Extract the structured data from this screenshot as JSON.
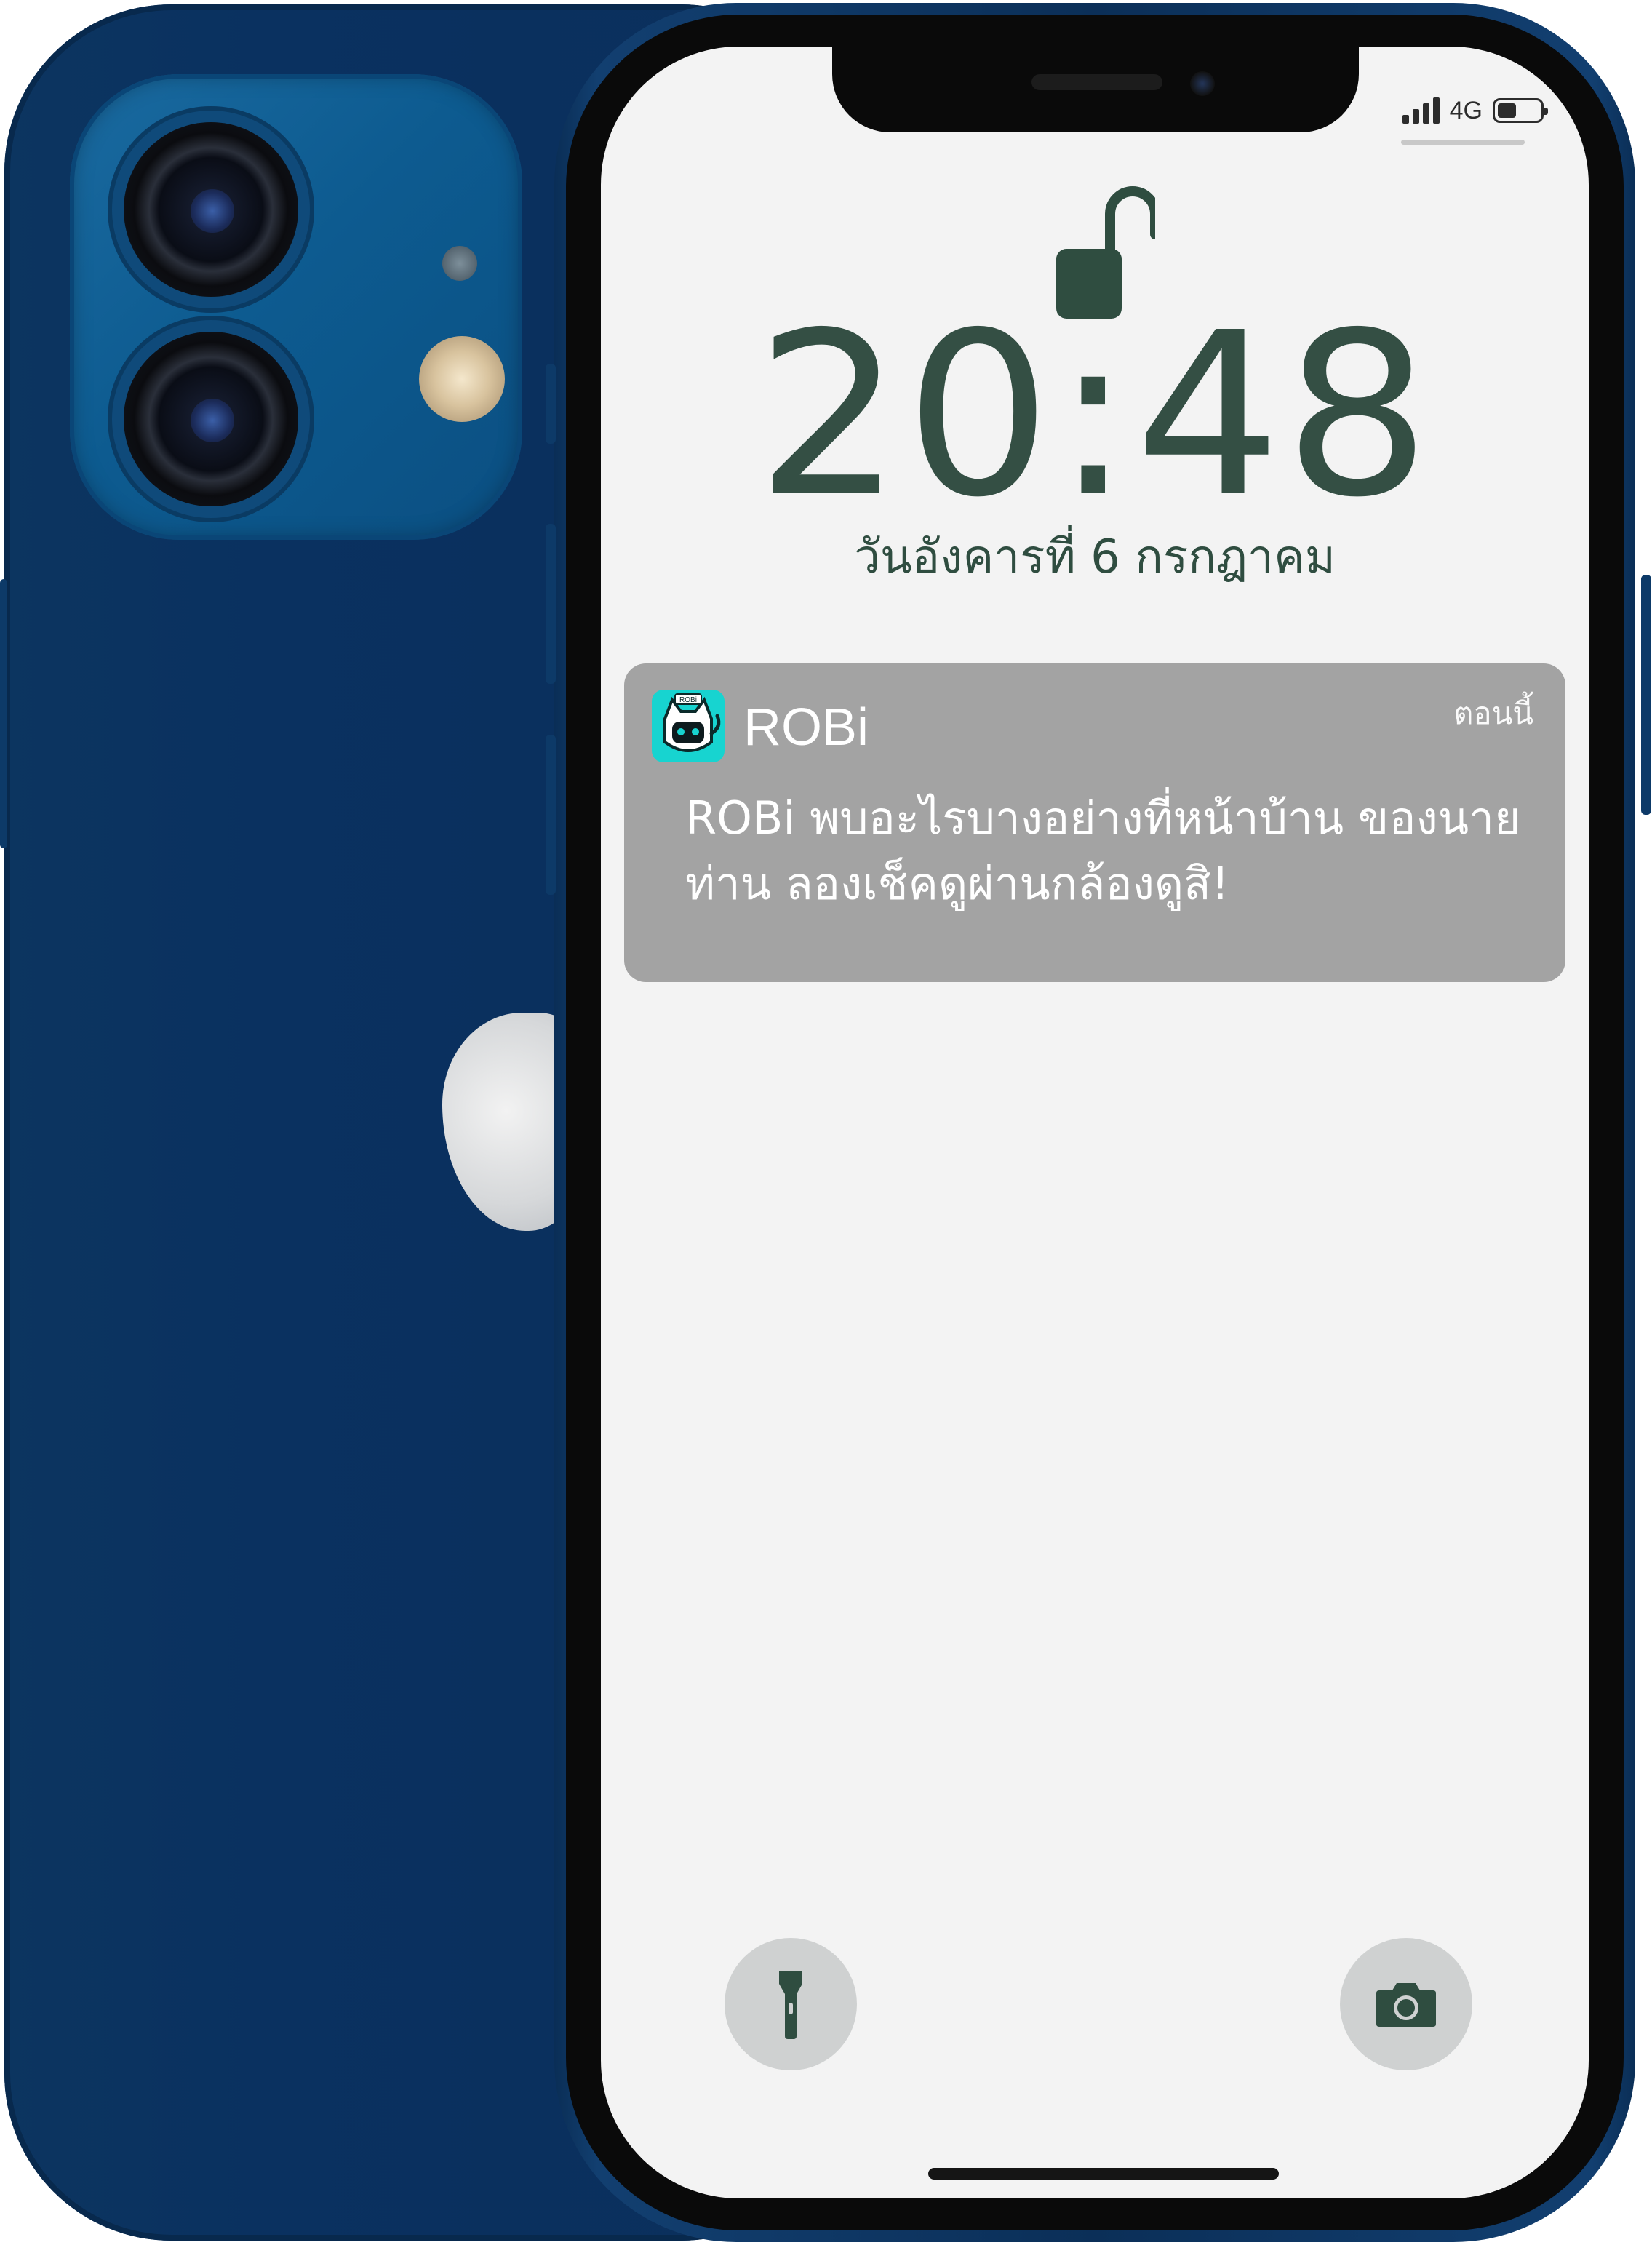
{
  "status_bar": {
    "network": "4G",
    "battery_level": 0.45
  },
  "lockscreen": {
    "time": "20:48",
    "date": "วันอังคารที่ 6 กรกฎาคม"
  },
  "notification": {
    "app_name": "ROBi",
    "app_icon_text": "ROBi",
    "time": "ตอนนี้",
    "message": "ROBi พบอะไรบางอย่างที่หน้าบ้าน ของนายท่าน ลองเช็คดูผ่านกล้องดูสิ!"
  },
  "quick_actions": {
    "left": "flashlight-icon",
    "right": "camera-icon"
  },
  "colors": {
    "screen_bg": "#f3f3f3",
    "clock_text": "#2f4d40",
    "notification_bg": "#a3a3a3",
    "app_icon_bg": "#17d4d0",
    "phone_body": "#0b2f5c"
  }
}
